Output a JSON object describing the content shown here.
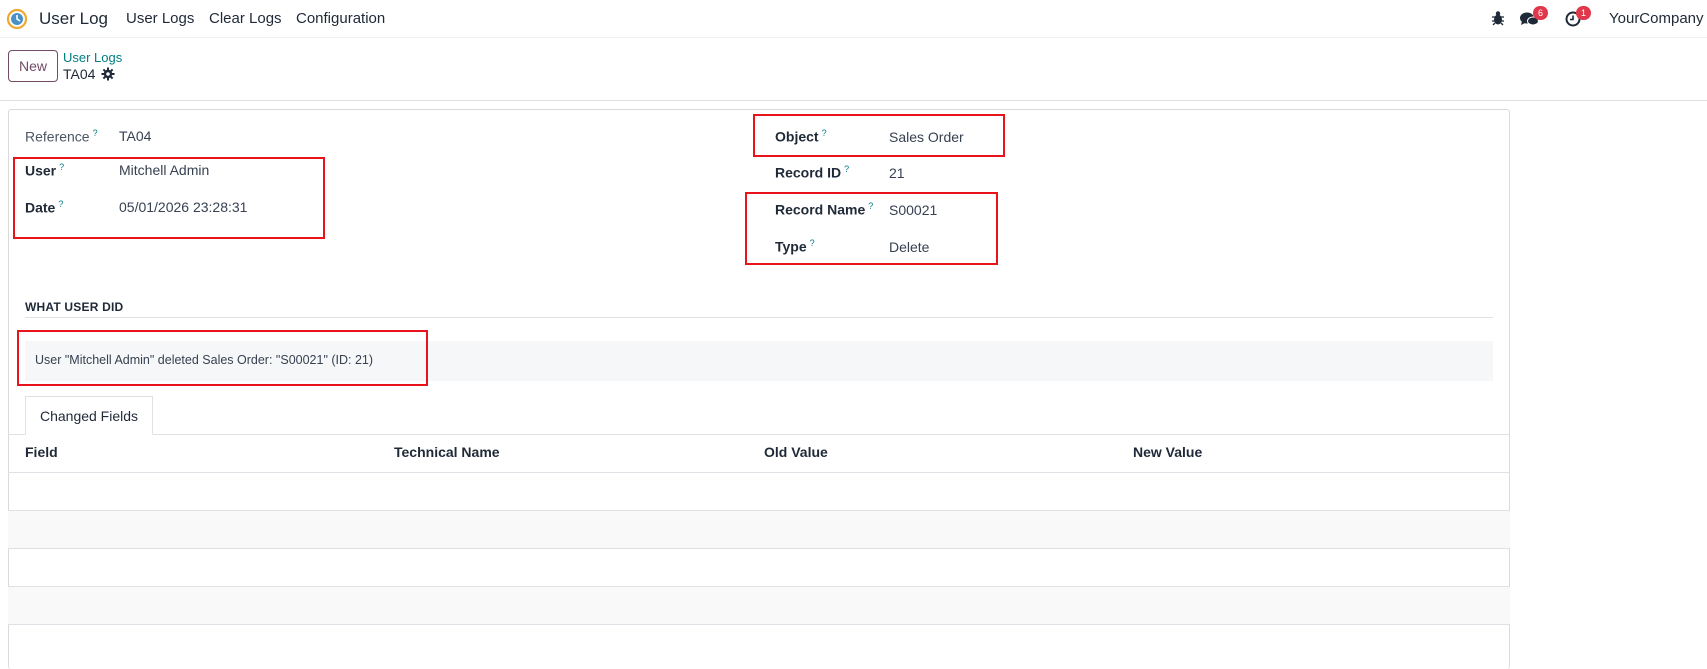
{
  "navbar": {
    "app_name": "User Log",
    "menu": [
      "User Logs",
      "Clear Logs",
      "Configuration"
    ],
    "messages_count": "6",
    "activities_count": "1",
    "company": "YourCompany"
  },
  "control_panel": {
    "new_label": "New",
    "breadcrumb_parent": "User Logs",
    "breadcrumb_current": "TA04"
  },
  "form": {
    "reference_label": "Reference",
    "reference_value": "TA04",
    "user_label": "User",
    "user_value": "Mitchell Admin",
    "date_label": "Date",
    "date_value": "05/01/2026 23:28:31",
    "object_label": "Object",
    "object_value": "Sales Order",
    "record_id_label": "Record ID",
    "record_id_value": "21",
    "record_name_label": "Record Name",
    "record_name_value": "S00021",
    "type_label": "Type",
    "type_value": "Delete",
    "help_mark": "?"
  },
  "section": {
    "title": "WHAT USER DID",
    "description": "User \"Mitchell Admin\" deleted Sales Order: \"S00021\" (ID: 21)"
  },
  "tabs": {
    "changed_fields": "Changed Fields"
  },
  "table": {
    "headers": [
      "Field",
      "Technical Name",
      "Old Value",
      "New Value"
    ]
  },
  "colors": {
    "accent": "#714b67",
    "link": "#017e84",
    "highlight": "#e8131b",
    "badge": "#e0374b"
  }
}
